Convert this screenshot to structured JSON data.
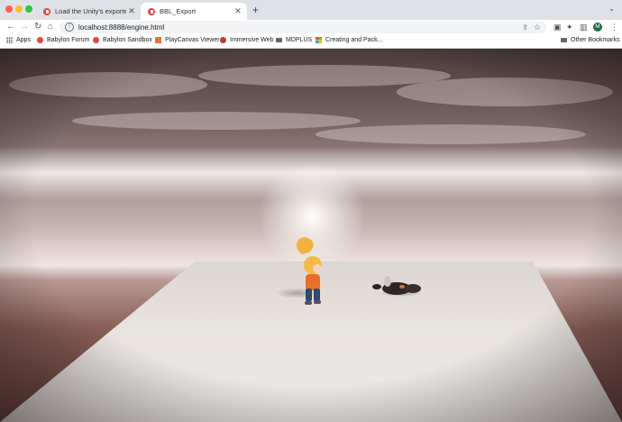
{
  "tabs": [
    {
      "title": "Load the Unity's exported sce",
      "active": false
    },
    {
      "title": "BBL_Export",
      "active": true
    }
  ],
  "address_bar": {
    "url": "localhost:8888/engine.html"
  },
  "profile_initial": "M",
  "bookmarks": [
    {
      "label": "Apps",
      "icon": "apps-grid-icon"
    },
    {
      "label": "Babylon Forum",
      "icon": "babylon-icon"
    },
    {
      "label": "Babylon Sandbox",
      "icon": "babylon-icon"
    },
    {
      "label": "PlayCanvas Viewer",
      "icon": "playcanvas-icon"
    },
    {
      "label": "Immersive Web",
      "icon": "immersive-web-icon"
    },
    {
      "label": "MDPLUS",
      "icon": "folder-icon"
    },
    {
      "label": "Creating and Pack...",
      "icon": "microsoft-icon"
    }
  ],
  "other_bookmarks": "Other Bookmarks",
  "scene": {
    "sky_colors": [
      "#4a3b3a",
      "#c6b5b0",
      "#efe6e4",
      "#875f57"
    ],
    "ground_color": "#ece7e3",
    "character_shirt": "#e6702a",
    "character_hair": "#f0b33f"
  },
  "colors": {
    "tabstrip": "#dee1e6",
    "profile": "#1e6b4c",
    "babylon_red": "#e0473f"
  }
}
